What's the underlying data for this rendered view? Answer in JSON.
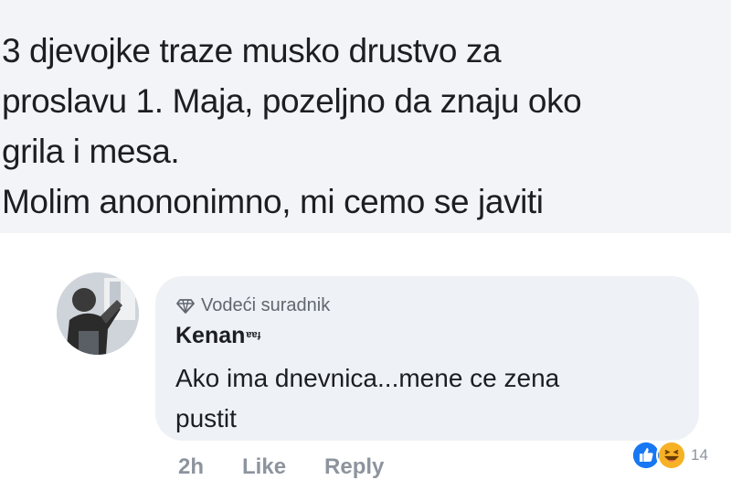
{
  "post": {
    "text": "3 djevojke traze musko drustvo za\nproslavu 1. Maja, pozeljno da znaju oko\ngrila i mesa.\nMolim anononimno, mi cemo se javiti"
  },
  "comment": {
    "badge_icon": "diamond-icon",
    "badge_label": "Vodeći suradnik",
    "author_name": "Kenan",
    "author_suffix": "ɐɐɟ",
    "text": "Ako ima dnevnica...mene ce zena\npustit",
    "actions": {
      "time": "2h",
      "like": "Like",
      "reply": "Reply"
    },
    "reactions": {
      "icons": [
        "like-reaction-icon",
        "haha-reaction-icon"
      ],
      "count": "14"
    }
  },
  "colors": {
    "post_background": "#f2f4f7",
    "bubble_background": "#eef1f5",
    "text": "#1c1e21",
    "muted": "#8d949e",
    "like_blue": "#1877f2",
    "haha_yellow": "#f7b125"
  }
}
